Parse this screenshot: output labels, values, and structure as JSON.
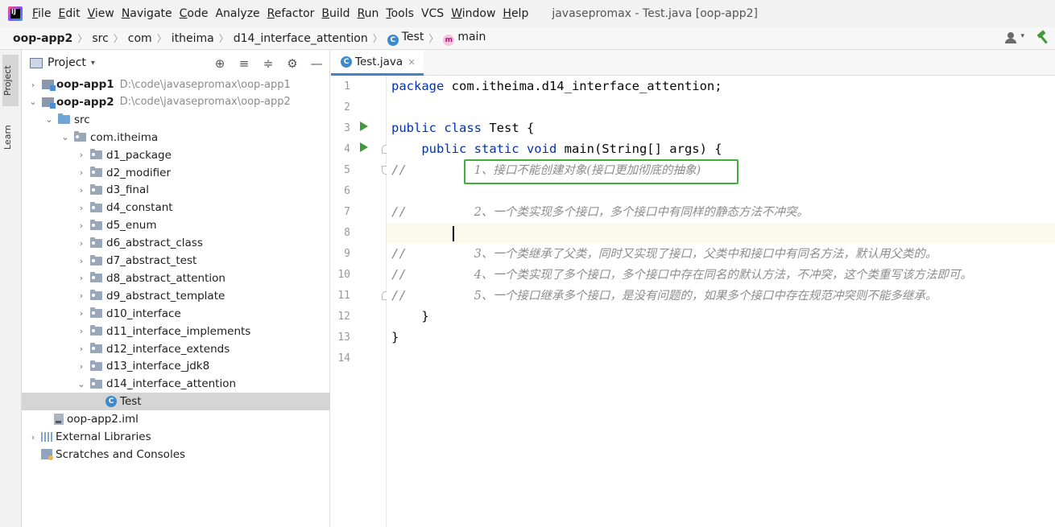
{
  "app": {
    "logo_text": "IJ",
    "window_title": "javasepromax - Test.java [oop-app2]"
  },
  "menu": [
    {
      "mnemonic": "F",
      "rest": "ile"
    },
    {
      "mnemonic": "E",
      "rest": "dit"
    },
    {
      "mnemonic": "V",
      "rest": "iew"
    },
    {
      "mnemonic": "N",
      "rest": "avigate"
    },
    {
      "mnemonic": "C",
      "rest": "ode"
    },
    {
      "mnemonic": "",
      "rest": "Analyze"
    },
    {
      "mnemonic": "R",
      "rest": "efactor"
    },
    {
      "mnemonic": "B",
      "rest": "uild"
    },
    {
      "mnemonic": "R",
      "rest": "un"
    },
    {
      "mnemonic": "T",
      "rest": "ools"
    },
    {
      "mnemonic": "",
      "rest": "VCS"
    },
    {
      "mnemonic": "W",
      "rest": "indow"
    },
    {
      "mnemonic": "H",
      "rest": "elp"
    }
  ],
  "breadcrumb": {
    "project": "oop-app2",
    "src": "src",
    "com": "com",
    "itheima": "itheima",
    "package": "d14_interface_attention",
    "class_icon": "C",
    "class": "Test",
    "method_icon": "m",
    "method": "main"
  },
  "nav_right": {
    "vcs_arrow": "▾"
  },
  "tool_strip": {
    "project": "Project",
    "learn": "Learn"
  },
  "project_panel": {
    "title": "Project",
    "dropdown": "▾",
    "tools": [
      "⊕",
      "≡",
      "≑",
      "⚙",
      "—"
    ]
  },
  "tree": [
    {
      "indent": 0,
      "chev": "›",
      "icon": "module",
      "label": "oop-app1",
      "bold": true,
      "path": "D:\\code\\javasepromax\\oop-app1"
    },
    {
      "indent": 0,
      "chev": "⌄",
      "icon": "module",
      "label": "oop-app2",
      "bold": true,
      "path": "D:\\code\\javasepromax\\oop-app2"
    },
    {
      "indent": 1,
      "chev": "⌄",
      "icon": "src",
      "label": "src"
    },
    {
      "indent": 2,
      "chev": "⌄",
      "icon": "pkg",
      "label": "com.itheima"
    },
    {
      "indent": 3,
      "chev": "›",
      "icon": "pkg",
      "label": "d1_package"
    },
    {
      "indent": 3,
      "chev": "›",
      "icon": "pkg",
      "label": "d2_modifier"
    },
    {
      "indent": 3,
      "chev": "›",
      "icon": "pkg",
      "label": "d3_final"
    },
    {
      "indent": 3,
      "chev": "›",
      "icon": "pkg",
      "label": "d4_constant"
    },
    {
      "indent": 3,
      "chev": "›",
      "icon": "pkg",
      "label": "d5_enum"
    },
    {
      "indent": 3,
      "chev": "›",
      "icon": "pkg",
      "label": "d6_abstract_class"
    },
    {
      "indent": 3,
      "chev": "›",
      "icon": "pkg",
      "label": "d7_abstract_test"
    },
    {
      "indent": 3,
      "chev": "›",
      "icon": "pkg",
      "label": "d8_abstract_attention"
    },
    {
      "indent": 3,
      "chev": "›",
      "icon": "pkg",
      "label": "d9_abstract_template"
    },
    {
      "indent": 3,
      "chev": "›",
      "icon": "pkg",
      "label": "d10_interface"
    },
    {
      "indent": 3,
      "chev": "›",
      "icon": "pkg",
      "label": "d11_interface_implements"
    },
    {
      "indent": 3,
      "chev": "›",
      "icon": "pkg",
      "label": "d12_interface_extends"
    },
    {
      "indent": 3,
      "chev": "›",
      "icon": "pkg",
      "label": "d13_interface_jdk8"
    },
    {
      "indent": 3,
      "chev": "⌄",
      "icon": "pkg",
      "label": "d14_interface_attention"
    },
    {
      "indent": 4,
      "chev": "",
      "icon": "class",
      "label": "Test",
      "selected": true
    },
    {
      "indent": 1,
      "chev": "",
      "icon": "iml",
      "label": "oop-app2.iml"
    },
    {
      "indent": 0,
      "chev": "›",
      "icon": "lib",
      "label": "External Libraries"
    },
    {
      "indent": 0,
      "chev": "",
      "icon": "scratch",
      "label": "Scratches and Consoles"
    }
  ],
  "editor": {
    "tab_label": "Test.java",
    "tab_close": "×",
    "line_numbers": [
      "1",
      "2",
      "3",
      "4",
      "5",
      "6",
      "7",
      "8",
      "9",
      "10",
      "11",
      "12",
      "13",
      "14"
    ],
    "lines": [
      [
        {
          "t": "package ",
          "c": "kw"
        },
        {
          "t": "com.itheima.d14_interface_attention;",
          "c": ""
        }
      ],
      [],
      [
        {
          "t": "public class ",
          "c": "kw"
        },
        {
          "t": "Test {",
          "c": ""
        }
      ],
      [
        {
          "t": "    public static void ",
          "c": "kw"
        },
        {
          "t": "main(String[] args) {",
          "c": ""
        }
      ],
      [
        {
          "t": "//         ",
          "c": "cmt"
        },
        {
          "t": "1、接口不能创建对象(接口更加彻底的抽象)",
          "c": "cmt-text"
        }
      ],
      [],
      [
        {
          "t": "//         ",
          "c": "cmt"
        },
        {
          "t": "2、一个类实现多个接口，多个接口中有同样的静态方法不冲突。",
          "c": "cmt-text"
        }
      ],
      [],
      [
        {
          "t": "//         ",
          "c": "cmt"
        },
        {
          "t": "3、一个类继承了父类，同时又实现了接口，父类中和接口中有同名方法，默认用父类的。",
          "c": "cmt-text"
        }
      ],
      [
        {
          "t": "//         ",
          "c": "cmt"
        },
        {
          "t": "4、一个类实现了多个接口，多个接口中存在同名的默认方法，不冲突，这个类重写该方法即可。",
          "c": "cmt-text"
        }
      ],
      [
        {
          "t": "//         ",
          "c": "cmt"
        },
        {
          "t": "5、一个接口继承多个接口，是没有问题的，如果多个接口中存在规范冲突则不能多继承。",
          "c": "cmt-text"
        }
      ],
      [
        {
          "t": "    }",
          "c": ""
        }
      ],
      [
        {
          "t": "}",
          "c": ""
        }
      ],
      []
    ]
  }
}
